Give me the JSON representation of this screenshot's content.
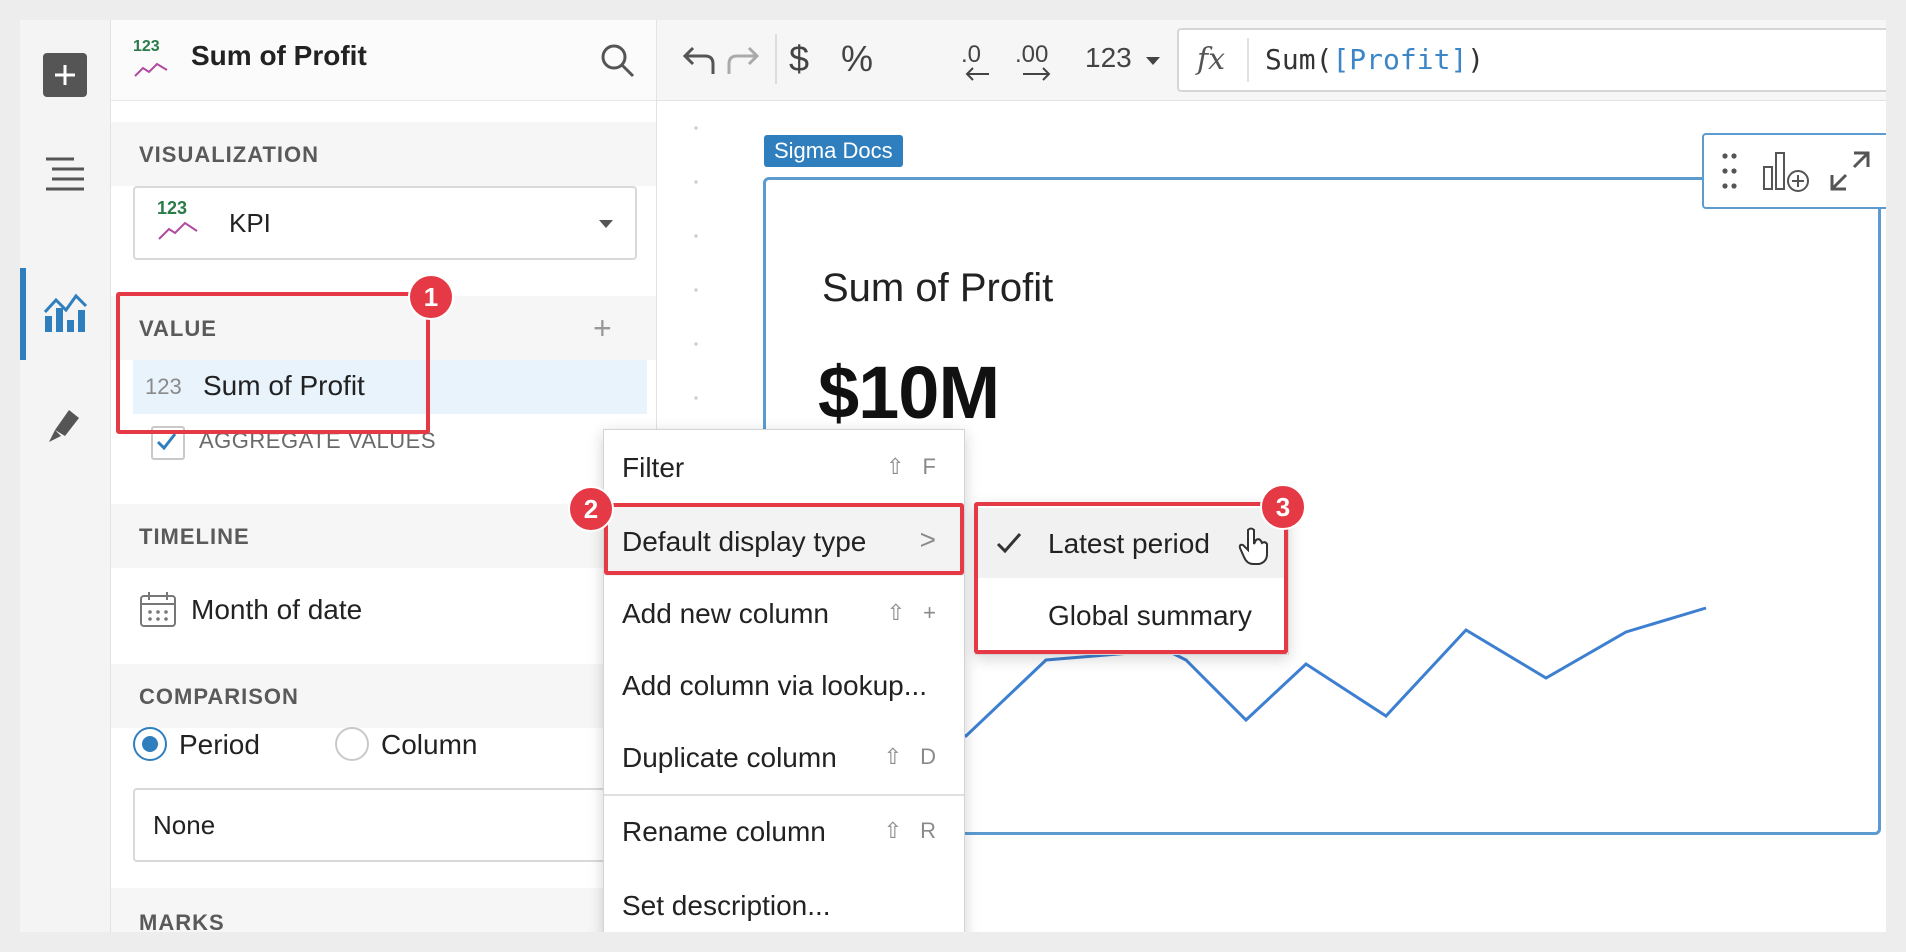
{
  "panel": {
    "icon_text": "123",
    "title": "Sum of Profit",
    "visualization_label": "VISUALIZATION",
    "visualization_value": "KPI",
    "value_label": "VALUE",
    "value_add": "+",
    "value_item_num": "123",
    "value_item": "Sum of Profit",
    "aggregate_label": "AGGREGATE VALUES",
    "timeline_label": "TIMELINE",
    "timeline_value": "Month of date",
    "comparison_label": "COMPARISON",
    "radio_period": "Period",
    "radio_column": "Column",
    "comparison_value": "None",
    "marks_label": "MARKS"
  },
  "toolbar": {
    "dollar": "$",
    "percent": "%",
    "number_format": "123",
    "fx": "fx",
    "formula_prefix": "Sum(",
    "formula_ref": "[Profit]",
    "formula_suffix": ")"
  },
  "canvas": {
    "doc_tag": "Sigma Docs",
    "kpi_title": "Sum of Profit",
    "kpi_value": "$10M"
  },
  "context_menu": {
    "items": [
      {
        "label": "Filter",
        "shortcut": "⇧ F"
      },
      {
        "label": "Default display type",
        "shortcut": ">"
      },
      {
        "label": "Add new column",
        "shortcut": "⇧ +"
      },
      {
        "label": "Add column via lookup...",
        "shortcut": ""
      },
      {
        "label": "Duplicate column",
        "shortcut": "⇧ D"
      },
      {
        "label": "Rename column",
        "shortcut": "⇧ R"
      },
      {
        "label": "Set description...",
        "shortcut": ""
      }
    ]
  },
  "submenu": {
    "items": [
      {
        "label": "Latest period",
        "checked": true
      },
      {
        "label": "Global summary",
        "checked": false
      }
    ]
  },
  "callouts": [
    "1",
    "2",
    "3"
  ],
  "colors": {
    "accent": "#2f7fbf",
    "callout": "#e63946",
    "sparkline": "#3d7fd1"
  }
}
